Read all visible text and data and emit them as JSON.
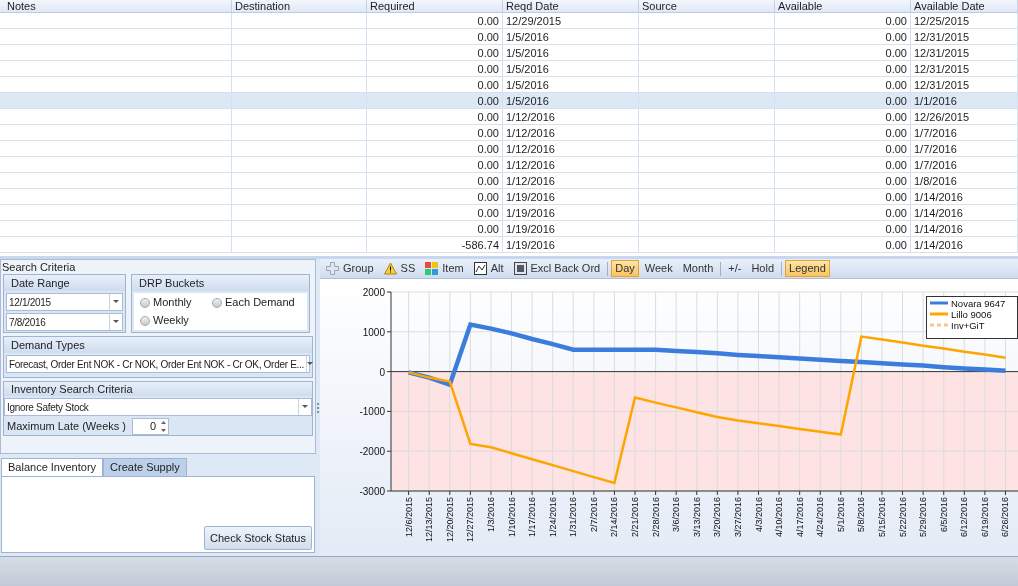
{
  "grid": {
    "columns": [
      "Notes",
      "Destination",
      "Required",
      "Reqd Date",
      "Source",
      "Available",
      "Available Date"
    ],
    "rows": [
      {
        "required": "0.00",
        "reqd_date": "12/29/2015",
        "available": "0.00",
        "available_date": "12/25/2015",
        "selected": false
      },
      {
        "required": "0.00",
        "reqd_date": "1/5/2016",
        "available": "0.00",
        "available_date": "12/31/2015",
        "selected": false
      },
      {
        "required": "0.00",
        "reqd_date": "1/5/2016",
        "available": "0.00",
        "available_date": "12/31/2015",
        "selected": false
      },
      {
        "required": "0.00",
        "reqd_date": "1/5/2016",
        "available": "0.00",
        "available_date": "12/31/2015",
        "selected": false
      },
      {
        "required": "0.00",
        "reqd_date": "1/5/2016",
        "available": "0.00",
        "available_date": "12/31/2015",
        "selected": false
      },
      {
        "required": "0.00",
        "reqd_date": "1/5/2016",
        "available": "0.00",
        "available_date": "1/1/2016",
        "selected": true
      },
      {
        "required": "0.00",
        "reqd_date": "1/12/2016",
        "available": "0.00",
        "available_date": "12/26/2015",
        "selected": false
      },
      {
        "required": "0.00",
        "reqd_date": "1/12/2016",
        "available": "0.00",
        "available_date": "1/7/2016",
        "selected": false
      },
      {
        "required": "0.00",
        "reqd_date": "1/12/2016",
        "available": "0.00",
        "available_date": "1/7/2016",
        "selected": false
      },
      {
        "required": "0.00",
        "reqd_date": "1/12/2016",
        "available": "0.00",
        "available_date": "1/7/2016",
        "selected": false
      },
      {
        "required": "0.00",
        "reqd_date": "1/12/2016",
        "available": "0.00",
        "available_date": "1/8/2016",
        "selected": false
      },
      {
        "required": "0.00",
        "reqd_date": "1/19/2016",
        "available": "0.00",
        "available_date": "1/14/2016",
        "selected": false
      },
      {
        "required": "0.00",
        "reqd_date": "1/19/2016",
        "available": "0.00",
        "available_date": "1/14/2016",
        "selected": false
      },
      {
        "required": "0.00",
        "reqd_date": "1/19/2016",
        "available": "0.00",
        "available_date": "1/14/2016",
        "selected": false
      },
      {
        "required": "-586.74",
        "reqd_date": "1/19/2016",
        "available": "0.00",
        "available_date": "1/14/2016",
        "selected": false
      }
    ]
  },
  "search_criteria": {
    "title": "Search Criteria",
    "date_range": {
      "title": "Date Range",
      "from": "12/1/2015",
      "to": "7/8/2016"
    },
    "drp_buckets": {
      "title": "DRP Buckets",
      "options": [
        {
          "label": "Monthly",
          "selected": false
        },
        {
          "label": "Each Demand",
          "selected": false
        },
        {
          "label": "Weekly",
          "selected": false
        }
      ]
    },
    "demand_types": {
      "title": "Demand Types",
      "value": "Forecast, Order Ent NOK - Cr NOK, Order Ent NOK - Cr OK, Order E..."
    },
    "inventory_search": {
      "title": "Inventory Search Criteria",
      "value": "Ignore Safety Stock",
      "max_late_label": "Maximum Late (Weeks )",
      "max_late": "0"
    }
  },
  "tabs": [
    {
      "label": "Balance Inventory",
      "selected": true
    },
    {
      "label": "Create Supply",
      "selected": false
    }
  ],
  "check_button": "Check Stock Status",
  "toolbar": [
    {
      "kind": "plus",
      "label": "Group",
      "selected": false
    },
    {
      "kind": "warning",
      "label": "SS",
      "selected": false
    },
    {
      "kind": "tiles",
      "label": "Item",
      "selected": false
    },
    {
      "kind": "frame",
      "label": "Alt",
      "selected": false
    },
    {
      "kind": "doc",
      "label": "Excl Back Ord",
      "selected": false
    },
    {
      "kind": "separator"
    },
    {
      "kind": "text",
      "label": "Day",
      "selected": true
    },
    {
      "kind": "text",
      "label": "Week",
      "selected": false
    },
    {
      "kind": "text",
      "label": "Month",
      "selected": false
    },
    {
      "kind": "separator"
    },
    {
      "kind": "text",
      "label": "+/-",
      "selected": false
    },
    {
      "kind": "text",
      "label": "Hold",
      "selected": false
    },
    {
      "kind": "separator"
    },
    {
      "kind": "text",
      "label": "Legend",
      "selected": true
    }
  ],
  "chart": {
    "chart_data": {
      "type": "line",
      "legend": "upper right",
      "grid": true,
      "categories": [
        "12/6/2015",
        "12/13/2015",
        "12/20/2015",
        "12/27/2015",
        "1/3/2016",
        "1/10/2016",
        "1/17/2016",
        "1/24/2016",
        "1/31/2016",
        "2/7/2016",
        "2/14/2016",
        "2/21/2016",
        "2/28/2016",
        "3/6/2016",
        "3/13/2016",
        "3/20/2016",
        "3/27/2016",
        "4/3/2016",
        "4/10/2016",
        "4/17/2016",
        "4/24/2016",
        "5/1/2016",
        "5/8/2016",
        "5/15/2016",
        "5/22/2016",
        "5/29/2016",
        "6/5/2016",
        "6/12/2016",
        "6/19/2016",
        "6/26/2016"
      ],
      "series": [
        {
          "name": "Novara 9647",
          "color": "#3b7ddd",
          "values": [
            -20,
            -150,
            -330,
            1180,
            1080,
            960,
            820,
            690,
            550,
            550,
            550,
            550,
            550,
            520,
            490,
            460,
            420,
            390,
            360,
            330,
            300,
            270,
            240,
            210,
            180,
            150,
            110,
            80,
            50,
            20
          ]
        },
        {
          "name": "Lillo 9006",
          "color": "#ffa500",
          "values": [
            -20,
            -150,
            -250,
            -1820,
            -1900,
            -2050,
            -2200,
            -2350,
            -2500,
            -2650,
            -2800,
            -650,
            -780,
            -900,
            -1020,
            -1140,
            -1230,
            -1300,
            -1370,
            -1440,
            -1510,
            -1580,
            880,
            810,
            730,
            650,
            580,
            500,
            430,
            350
          ]
        }
      ],
      "bands": [
        {
          "axis": "y",
          "from": -3000,
          "to": 0,
          "color": "#fde3e3"
        }
      ],
      "ylim": [
        -3000,
        2000
      ],
      "yticks": [
        -3000,
        -2000,
        -1000,
        0,
        1000,
        2000
      ]
    },
    "legend_extra": [
      {
        "label": "Inv+GiT",
        "color": "#f8c68a",
        "kind": "dashed"
      }
    ]
  }
}
